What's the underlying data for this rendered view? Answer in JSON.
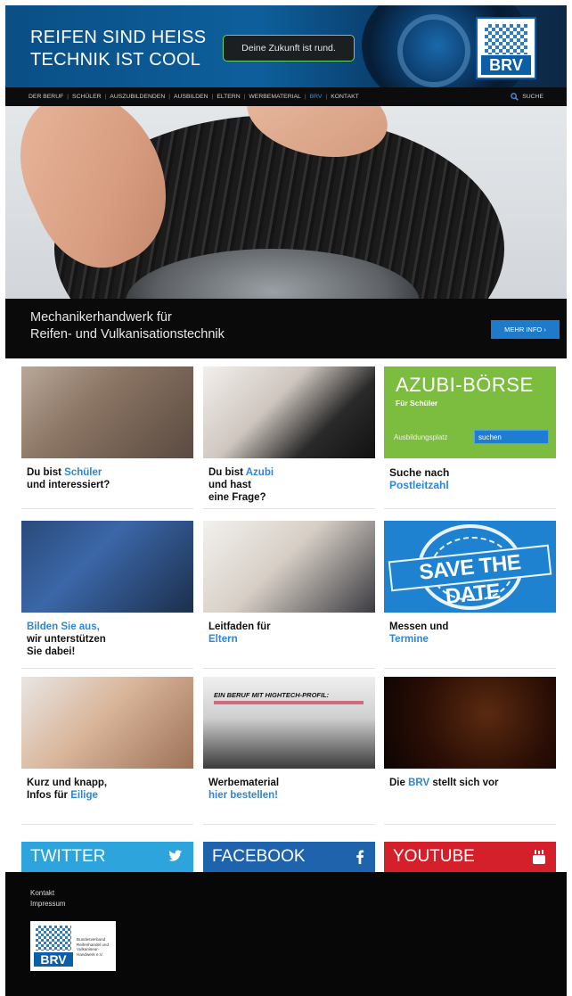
{
  "header": {
    "slogan_line1": "REIFEN SIND HEISS",
    "slogan_line2": "TECHNIK IST COOL",
    "tagline": "Deine Zukunft ist rund.",
    "logo_text": "BRV"
  },
  "nav": {
    "items": [
      {
        "label": "DER BERUF"
      },
      {
        "label": "SCHÜLER"
      },
      {
        "label": "AUSZUBILDENDEN"
      },
      {
        "label": "AUSBILDEN"
      },
      {
        "label": "ELTERN"
      },
      {
        "label": "WERBEMATERIAL"
      },
      {
        "label": "BRV"
      },
      {
        "label": "KONTAKT"
      }
    ],
    "active": "BRV",
    "search_label": "SUCHE"
  },
  "hero": {
    "caption_line1": "Mechanikerhandwerk für",
    "caption_line2": "Reifen- und Vulkanisationstechnik",
    "button_label": "MEHR INFO ›"
  },
  "tiles": [
    {
      "pre": "Du bist ",
      "hl": "Schüler",
      "line2": "und interessiert?",
      "line3": ""
    },
    {
      "pre": "Du bist ",
      "hl": "Azubi",
      "line2": "und hast",
      "line3": "eine Frage?"
    },
    {
      "pre": "Suche nach",
      "hl": "",
      "line2": "Postleitzahl",
      "line3": ""
    },
    {
      "hl": "Bilden Sie aus,",
      "line2": "wir unterstützen",
      "line3": "Sie dabei!"
    },
    {
      "pre": "Leitfaden für",
      "hl": "",
      "line2": "Eltern",
      "line3": ""
    },
    {
      "pre": "Messen und",
      "hl": "",
      "line2": "Termine",
      "line3": ""
    },
    {
      "pre": "Kurz und knapp,",
      "hl": "",
      "line2a": "Infos für ",
      "line2b": "Eilige",
      "line3": ""
    },
    {
      "pre": "Werbematerial",
      "hl": "",
      "line2": "hier bestellen!",
      "line3": ""
    },
    {
      "pre": "Die ",
      "hl": "BRV",
      "post": " stellt sich vor",
      "line3": ""
    }
  ],
  "azubi": {
    "title": "AZUBI-BÖRSE",
    "subtitle": "Für Schüler",
    "field_label": "Ausbildungsplatz",
    "field_value": "suchen"
  },
  "save_the_date": {
    "text": "SAVE THE DATE"
  },
  "magazine": {
    "headline": "EIN BERUF MIT HIGHTECH-PROFIL:"
  },
  "social": {
    "twitter": "TWITTER",
    "facebook": "FACEBOOK",
    "youtube": "YOUTUBE"
  },
  "footer": {
    "kontakt": "Kontakt",
    "impressum": "Impressum",
    "logo_text": "BRV",
    "logo_desc": "Bundesverband Reifenhandel und Vulkaniseur-Handwerk e.V."
  },
  "colors": {
    "accent": "#2e86d6",
    "azubi_green": "#7cbc3f",
    "twitter": "#2ea4dc",
    "facebook": "#1f63ad",
    "youtube": "#d3202a"
  }
}
